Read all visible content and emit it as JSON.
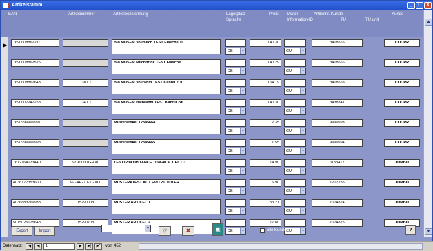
{
  "window": {
    "title": "Artikelstamm",
    "minimize": "_",
    "maximize": "□",
    "close": "X"
  },
  "columns": {
    "ean": "EAN",
    "artikelnummer": "Artikelnummer",
    "bezeichnung": "Artikelbezeichnung",
    "lagerplatz": "Lagerplatz",
    "sprache": "Sprache",
    "preis": "Preis",
    "mwst": "MwST",
    "information_id": "Information-ID",
    "artikelnr_kunde": "Artikelnr. Kunde",
    "tu": "TU",
    "tu_unit": "TU unit",
    "kunde": "Kunde"
  },
  "rows": [
    {
      "ean": "7690008862211",
      "artikelnummer": "",
      "bezeichnung": "Bio MUSFM Vollmilch TEST Flasche 1L",
      "lagerplatz": "",
      "sprache": "DE",
      "preis": "140.30",
      "mwst": "",
      "info": "CU",
      "artnr_kunde": "3418565",
      "kunde": "COOPR"
    },
    {
      "ean": "7690008862525",
      "artikelnummer": "",
      "bezeichnung": "Bio MUSFM Milchdrink TEST Flasche",
      "lagerplatz": "",
      "sprache": "DE",
      "preis": "140.29",
      "mwst": "",
      "info": "CU",
      "artnr_kunde": "3418566",
      "kunde": "COOPR"
    },
    {
      "ean": "7690008862643",
      "artikelnummer": "1307.1",
      "bezeichnung": "Bio MUSFM Vollrahm TEST Kännli 2DL",
      "lagerplatz": "",
      "sprache": "DE",
      "preis": "164.19",
      "mwst": "",
      "info": "CU",
      "artnr_kunde": "3418568",
      "kunde": "COOPR"
    },
    {
      "ean": "7690007242258",
      "artikelnummer": "1341.1",
      "bezeichnung": "Bio MUSFM Halbrahm TEST Kännli 2dl",
      "lagerplatz": "",
      "sprache": "DE",
      "preis": "140.30",
      "mwst": "",
      "info": "CU",
      "artnr_kunde": "3438341",
      "kunde": "COOPR"
    },
    {
      "ean": "7690999999997",
      "artikelnummer": "",
      "bezeichnung": "Musterartikel 12345664",
      "lagerplatz": "",
      "sprache": "DE",
      "preis": "2.35",
      "mwst": "",
      "info": "CU",
      "artnr_kunde": "9999993",
      "kunde": "COOPR"
    },
    {
      "ean": "7690999999998",
      "artikelnummer": "",
      "bezeichnung": "Musterartikel 12345665",
      "lagerplatz": "",
      "sprache": "DE",
      "preis": "1.55",
      "mwst": "",
      "info": "CU",
      "artnr_kunde": "9999994",
      "kunde": "COOPR"
    },
    {
      "ean": "7612164073440",
      "artikelnummer": "SZ-PILD1G-4XL",
      "bezeichnung": "TEST1234 DISTANCE 10W-40 4LT PILOT",
      "lagerplatz": "",
      "sprache": "DE",
      "preis": "14.90",
      "mwst": "",
      "info": "CU",
      "artnr_kunde": "1153412",
      "kunde": "JUMBO"
    },
    {
      "ean": "4036177353600",
      "artikelnummer": "MZ-AE2TT-1.2XI L",
      "bezeichnung": "MUSTERATEST ACT EVO 2T 1LITER",
      "lagerplatz": "",
      "sprache": "DE",
      "preis": "6.90",
      "mwst": "",
      "info": "CU",
      "artnr_kunde": "1207285",
      "kunde": "JUMBO"
    },
    {
      "ean": "4036883769938",
      "artikelnummer": "15290008",
      "bezeichnung": "MUSTER ARTIKEL 1",
      "lagerplatz": "",
      "sprache": "DE",
      "preis": "53.21",
      "mwst": "",
      "info": "CU",
      "artnr_kunde": "1074824",
      "kunde": "JUMBO"
    },
    {
      "ean": "5015025175648",
      "artikelnummer": "15290708",
      "bezeichnung": "MUSTER ARTIKEL 2",
      "lagerplatz": "",
      "sprache": "DE",
      "preis": "17.80",
      "mwst": "",
      "info": "CU",
      "artnr_kunde": "1074825",
      "kunde": "JUMBO"
    }
  ],
  "toolbar": {
    "export": "Export",
    "import": "Import",
    "filter_value": "",
    "filter_icon": "funnel-icon",
    "clear_filter_icon": "funnel-clear-icon",
    "save_icon": "floppy-disk-icon",
    "alle_kunden": "alle Kunden",
    "help_icon": "question-icon"
  },
  "navigation": {
    "label": "Datensatz:",
    "current": "1",
    "of_label": "von",
    "total": "452"
  }
}
